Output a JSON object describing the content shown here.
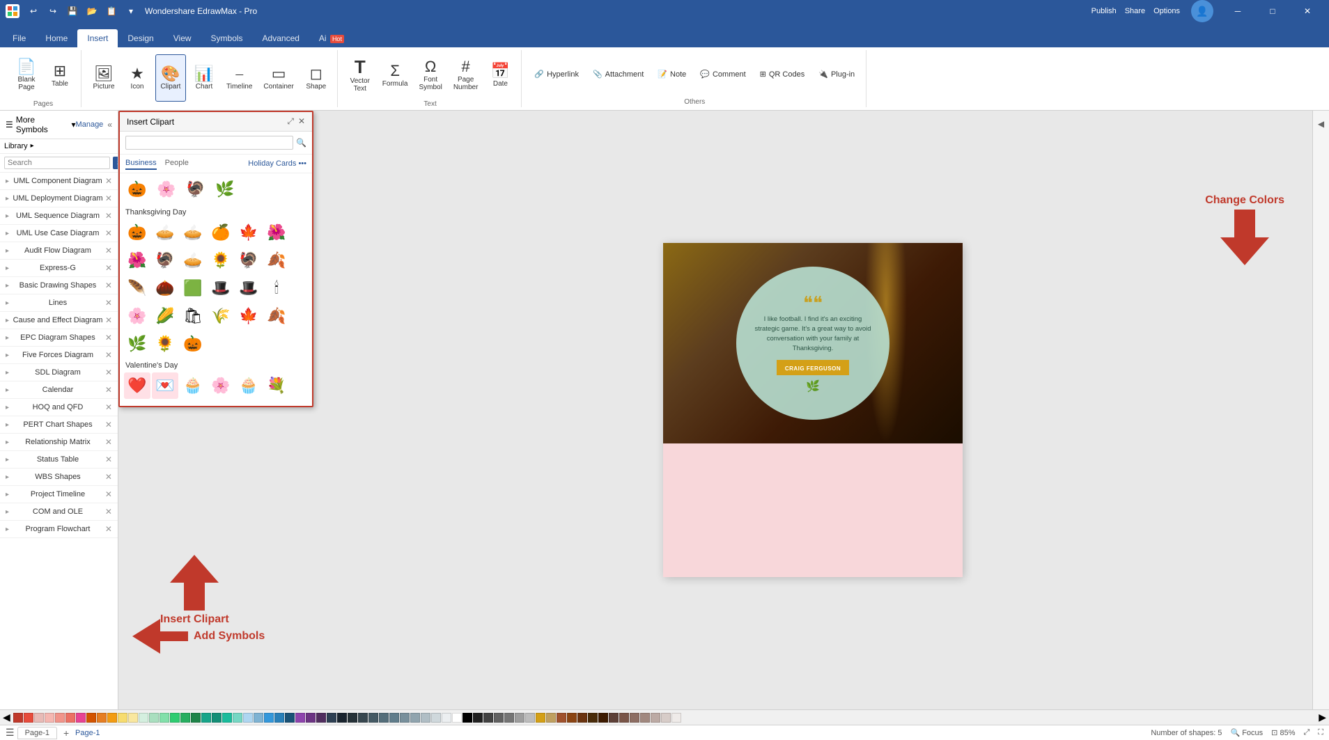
{
  "app": {
    "title": "Wondershare EdrawMax - Pro",
    "window_controls": [
      "minimize",
      "maximize",
      "close"
    ]
  },
  "quick_access": {
    "buttons": [
      "undo",
      "redo",
      "save",
      "open",
      "new",
      "dropdown"
    ]
  },
  "ribbon": {
    "tabs": [
      "File",
      "Home",
      "Insert",
      "Design",
      "View",
      "Symbols",
      "Advanced",
      "Ai"
    ],
    "active_tab": "Insert",
    "ai_badge": "Hot",
    "groups": [
      {
        "label": "Pages",
        "items": [
          {
            "id": "blank-page",
            "label": "Blank\nPage",
            "icon": "📄"
          },
          {
            "id": "table",
            "label": "Table",
            "icon": "⊞"
          }
        ]
      },
      {
        "label": "",
        "items": [
          {
            "id": "picture",
            "label": "Picture",
            "icon": "🖼"
          },
          {
            "id": "icon",
            "label": "Icon",
            "icon": "★"
          },
          {
            "id": "clipart",
            "label": "Clipart",
            "icon": "🎨",
            "active": true
          },
          {
            "id": "chart",
            "label": "Chart",
            "icon": "📊"
          },
          {
            "id": "timeline",
            "label": "Timeline",
            "icon": "⎯"
          },
          {
            "id": "container",
            "label": "Container",
            "icon": "▭"
          },
          {
            "id": "shape",
            "label": "Shape",
            "icon": "◻"
          }
        ]
      },
      {
        "label": "Text",
        "items": [
          {
            "id": "vector-text",
            "label": "Vector\nText",
            "icon": "T"
          },
          {
            "id": "formula",
            "label": "Formula",
            "icon": "Σ"
          },
          {
            "id": "font-symbol",
            "label": "Font\nSymbol",
            "icon": "Ω"
          },
          {
            "id": "page-number",
            "label": "Page\nNumber",
            "icon": "#"
          },
          {
            "id": "date",
            "label": "Date",
            "icon": "📅"
          }
        ]
      },
      {
        "label": "Others",
        "items": [
          {
            "id": "hyperlink",
            "label": "Hyperlink",
            "icon": "🔗"
          },
          {
            "id": "attachment",
            "label": "Attachment",
            "icon": "📎"
          },
          {
            "id": "note",
            "label": "Note",
            "icon": "📝"
          },
          {
            "id": "comment",
            "label": "Comment",
            "icon": "💬"
          },
          {
            "id": "qr-codes",
            "label": "QR\nCodes",
            "icon": "⊞"
          },
          {
            "id": "plug-in",
            "label": "Plug-in",
            "icon": "🔌"
          }
        ]
      }
    ],
    "top_right": {
      "publish": "Publish",
      "share": "Share",
      "options": "Options"
    }
  },
  "sidebar": {
    "title": "More Symbols",
    "has_dropdown": true,
    "manage_label": "Manage",
    "library_label": "Library",
    "search_placeholder": "Search",
    "search_btn": "Search",
    "sections": [
      {
        "id": "uml-component",
        "label": "UML Component Diagram",
        "closeable": true
      },
      {
        "id": "uml-deployment",
        "label": "UML Deployment Diagram",
        "closeable": true
      },
      {
        "id": "uml-sequence",
        "label": "UML Sequence Diagram",
        "closeable": true
      },
      {
        "id": "uml-use-case",
        "label": "UML Use Case Diagram",
        "closeable": true
      },
      {
        "id": "audit-flow",
        "label": "Audit Flow Diagram",
        "closeable": true
      },
      {
        "id": "express-g",
        "label": "Express-G",
        "closeable": true
      },
      {
        "id": "basic-drawing",
        "label": "Basic Drawing Shapes",
        "closeable": true
      },
      {
        "id": "lines",
        "label": "Lines",
        "closeable": true
      },
      {
        "id": "cause-effect",
        "label": "Cause and Effect Diagram",
        "closeable": true
      },
      {
        "id": "epc-diagram",
        "label": "EPC Diagram Shapes",
        "closeable": true
      },
      {
        "id": "five-forces",
        "label": "Five Forces Diagram",
        "closeable": true
      },
      {
        "id": "sdl-diagram",
        "label": "SDL Diagram",
        "closeable": true
      },
      {
        "id": "calendar",
        "label": "Calendar",
        "closeable": true
      },
      {
        "id": "hoq-qfd",
        "label": "HOQ and QFD",
        "closeable": true
      },
      {
        "id": "pert-chart",
        "label": "PERT Chart Shapes",
        "closeable": true
      },
      {
        "id": "relationship-matrix",
        "label": "Relationship Matrix",
        "closeable": true
      },
      {
        "id": "status-table",
        "label": "Status Table",
        "closeable": true
      },
      {
        "id": "wbs-shapes",
        "label": "WBS Shapes",
        "closeable": true
      },
      {
        "id": "project-timeline",
        "label": "Project Timeline",
        "closeable": true
      },
      {
        "id": "com-ole",
        "label": "COM and OLE",
        "closeable": true
      },
      {
        "id": "program-flowchart",
        "label": "Program Flowchart",
        "closeable": true
      }
    ]
  },
  "clipart_panel": {
    "title": "Insert Clipart",
    "search_placeholder": "",
    "tabs": [
      "Business",
      "People"
    ],
    "active_tab": "Business",
    "holiday_link": "Holiday Cards",
    "sections": [
      {
        "title": "Thanksgiving Day",
        "items": [
          "🎃",
          "🌸",
          "🦃",
          "🌿",
          "🎃",
          "🥧",
          "🥧",
          "🍊",
          "🍁",
          "🌺",
          "🌺",
          "🦃",
          "🥧",
          "🌻",
          "🦃",
          "🍂",
          "🪶",
          "🌰",
          "🟩",
          "🎩",
          "🎩",
          "🕯",
          "🌸",
          "🌽",
          "🛍",
          "🌾",
          "🍁",
          "🍂",
          "🌿",
          "🌻",
          "🎃"
        ]
      },
      {
        "title": "Valentine's Day",
        "items": [
          "❤️",
          "💌",
          "🧁",
          "🌸",
          "🧁",
          "💐"
        ]
      }
    ]
  },
  "card": {
    "quote_marks": "❝❝",
    "quote_text": "I like football. I find it's an exciting strategic game. It's a great way to avoid conversation with your family at Thanksgiving.",
    "attribution": "CRAIG FERGUSON",
    "leaf_emoji": "🌿"
  },
  "annotations": {
    "insert_clipart": "Insert Clipart",
    "add_symbols": "Add Symbols",
    "change_colors": "Change Colors"
  },
  "status_bar": {
    "shape_count": "Number of shapes: 5",
    "focus": "Focus",
    "zoom": "85%",
    "page": "Page-1",
    "fit_btn": "⊡"
  },
  "pages": [
    {
      "id": "page-1",
      "label": "Page-1",
      "active": true
    }
  ],
  "colors": [
    "#c0392b",
    "#e74c3c",
    "#e8bab6",
    "#f5b7b1",
    "#f1948a",
    "#ec7063",
    "#e84393",
    "#d35400",
    "#e67e22",
    "#f39c12",
    "#f7dc6f",
    "#f9e79f",
    "#d4efdf",
    "#a9dfbf",
    "#82e0aa",
    "#2ecc71",
    "#27ae60",
    "#1e8449",
    "#17a589",
    "#148f77",
    "#1abc9c",
    "#76d7c4",
    "#aed6f1",
    "#7fb3d3",
    "#3498db",
    "#2980b9",
    "#1a5276",
    "#8e44ad",
    "#6c3483",
    "#512e5f",
    "#2e4053",
    "#1a252f",
    "#263238",
    "#37474f",
    "#455a64",
    "#546e7a",
    "#607d8b",
    "#78909c",
    "#90a4ae",
    "#b0bec5",
    "#cfd8dc",
    "#eceff1",
    "#ffffff",
    "#000000",
    "#212121",
    "#424242",
    "#616161",
    "#757575",
    "#9e9e9e",
    "#bdbdbd",
    "#d4a017",
    "#c0a060",
    "#a0522d",
    "#8b4513",
    "#6b3410",
    "#4a2c0a",
    "#3d1a00",
    "#5d4037",
    "#795548",
    "#8d6e63",
    "#a1887f",
    "#bcaaa4",
    "#d7ccc8",
    "#efebe9"
  ]
}
